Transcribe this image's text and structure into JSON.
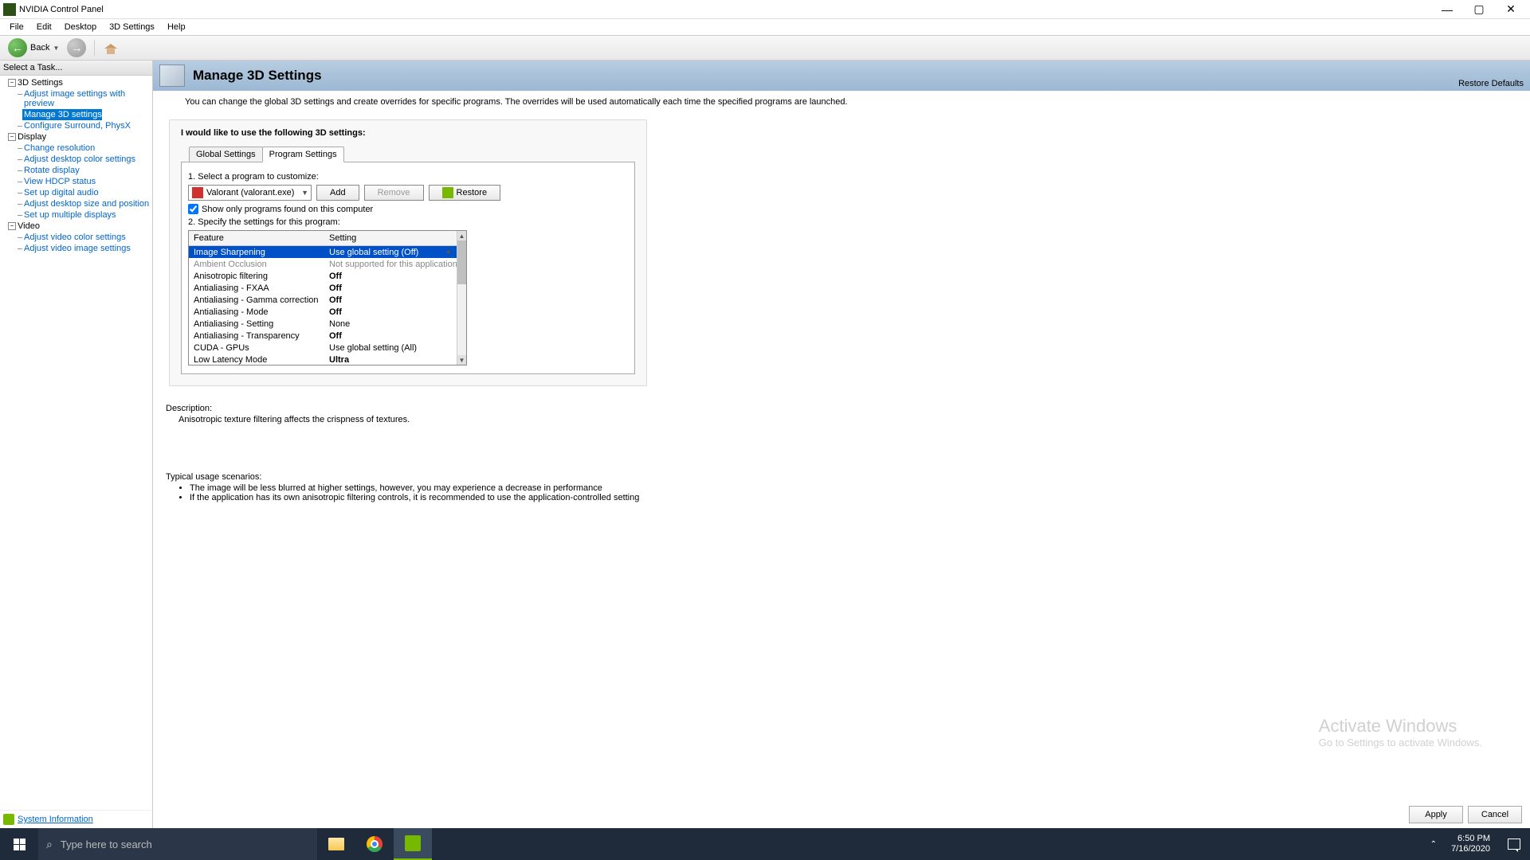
{
  "window": {
    "title": "NVIDIA Control Panel"
  },
  "menu": {
    "file": "File",
    "edit": "Edit",
    "desktop": "Desktop",
    "threeD": "3D Settings",
    "help": "Help"
  },
  "toolbar": {
    "back": "Back"
  },
  "sidebar": {
    "header": "Select a Task...",
    "groups": [
      {
        "label": "3D Settings",
        "items": [
          "Adjust image settings with preview",
          "Manage 3D settings",
          "Configure Surround, PhysX"
        ],
        "selected_index": 1
      },
      {
        "label": "Display",
        "items": [
          "Change resolution",
          "Adjust desktop color settings",
          "Rotate display",
          "View HDCP status",
          "Set up digital audio",
          "Adjust desktop size and position",
          "Set up multiple displays"
        ]
      },
      {
        "label": "Video",
        "items": [
          "Adjust video color settings",
          "Adjust video image settings"
        ]
      }
    ],
    "sysinfo": "System Information"
  },
  "header": {
    "title": "Manage 3D Settings",
    "restore": "Restore Defaults"
  },
  "intro": "You can change the global 3D settings and create overrides for specific programs. The overrides will be used automatically each time the specified programs are launched.",
  "panel": {
    "label": "I would like to use the following 3D settings:",
    "tabs": {
      "global": "Global Settings",
      "program": "Program Settings"
    },
    "step1": "1. Select a program to customize:",
    "program_selected": "Valorant (valorant.exe)",
    "buttons": {
      "add": "Add",
      "remove": "Remove",
      "restore": "Restore"
    },
    "show_only": {
      "checked": true,
      "label": "Show only programs found on this computer"
    },
    "step2": "2. Specify the settings for this program:",
    "columns": {
      "feature": "Feature",
      "setting": "Setting"
    },
    "rows": [
      {
        "feature": "Image Sharpening",
        "setting": "Use global setting (Off)",
        "selected": true,
        "dropdown": true
      },
      {
        "feature": "Ambient Occlusion",
        "setting": "Not supported for this application",
        "disabled": true
      },
      {
        "feature": "Anisotropic filtering",
        "setting": "Off",
        "bold": true
      },
      {
        "feature": "Antialiasing - FXAA",
        "setting": "Off",
        "bold": true
      },
      {
        "feature": "Antialiasing - Gamma correction",
        "setting": "Off",
        "bold": true
      },
      {
        "feature": "Antialiasing - Mode",
        "setting": "Off",
        "bold": true
      },
      {
        "feature": "Antialiasing - Setting",
        "setting": "None"
      },
      {
        "feature": "Antialiasing - Transparency",
        "setting": "Off",
        "bold": true
      },
      {
        "feature": "CUDA - GPUs",
        "setting": "Use global setting (All)"
      },
      {
        "feature": "Low Latency Mode",
        "setting": "Ultra",
        "bold": true
      }
    ]
  },
  "description": {
    "header": "Description:",
    "text": "Anisotropic texture filtering affects the crispness of textures.",
    "usage_header": "Typical usage scenarios:",
    "usage": [
      "The image will be less blurred at higher settings, however, you may experience a decrease in performance",
      "If the application has its own anisotropic filtering controls, it is recommended to use the application-controlled setting"
    ]
  },
  "watermark": {
    "line1": "Activate Windows",
    "line2": "Go to Settings to activate Windows."
  },
  "buttons_bottom": {
    "apply": "Apply",
    "cancel": "Cancel"
  },
  "taskbar": {
    "search_placeholder": "Type here to search",
    "time": "6:50 PM",
    "date": "7/16/2020"
  }
}
